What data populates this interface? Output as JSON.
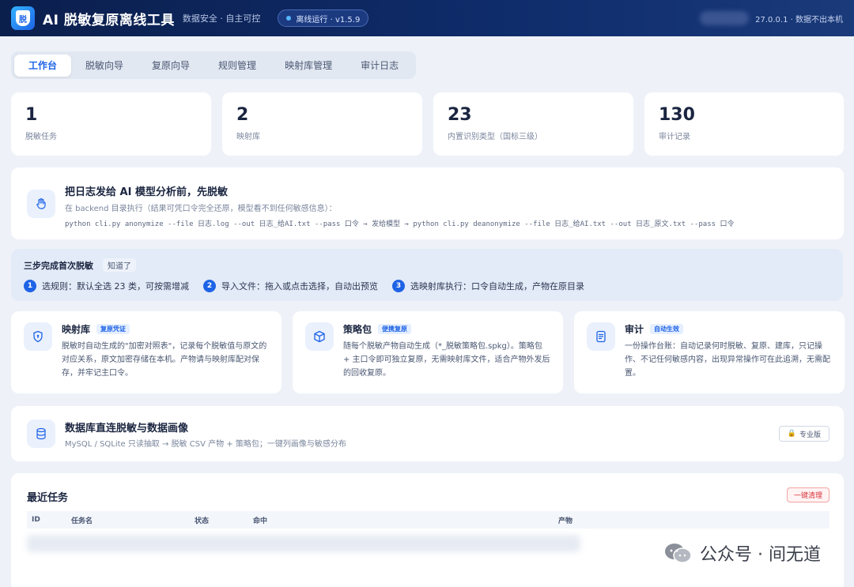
{
  "header": {
    "logo_text": "脱",
    "title": "AI 脱敏复原离线工具",
    "subtitle": "数据安全 · 自主可控",
    "status": "离线运行 · v1.5.9",
    "right_text": "27.0.0.1 · 数据不出本机"
  },
  "tabs": [
    {
      "label": "工作台",
      "active": true
    },
    {
      "label": "脱敏向导"
    },
    {
      "label": "复原向导"
    },
    {
      "label": "规则管理"
    },
    {
      "label": "映射库管理"
    },
    {
      "label": "审计日志"
    }
  ],
  "stats": [
    {
      "value": "1",
      "label": "脱敏任务"
    },
    {
      "value": "2",
      "label": "映射库"
    },
    {
      "value": "23",
      "label": "内置识别类型（国标三级）"
    },
    {
      "value": "130",
      "label": "审计记录"
    }
  ],
  "hero": {
    "title": "把日志发给 AI 模型分析前，先脱敏",
    "desc": "在 backend 目录执行（结果可凭口令完全还原，模型看不到任何敏感信息）：",
    "cmd": "python cli.py anonymize --file 日志.log --out 日志_给AI.txt --pass 口令 → 发给模型 → python cli.py deanonymize --file 日志_给AI.txt --out 日志_原文.txt --pass 口令"
  },
  "steps": {
    "title": "三步完成首次脱敏",
    "ack": "知道了",
    "items": [
      {
        "num": "1",
        "text": "选规则：默认全选 23 类，可按需增减"
      },
      {
        "num": "2",
        "text": "导入文件：拖入或点击选择，自动出预览"
      },
      {
        "num": "3",
        "text": "选映射库执行：口令自动生成，产物在原目录"
      }
    ]
  },
  "features": [
    {
      "icon": "shield-icon",
      "title": "映射库",
      "badge": "复原凭证",
      "desc": "脱敏时自动生成的\"加密对照表\"，记录每个脱敏值与原文的对应关系，原文加密存储在本机。产物请与映射库配对保存，并牢记主口令。"
    },
    {
      "icon": "package-icon",
      "title": "策略包",
      "badge": "便携复原",
      "desc": "随每个脱敏产物自动生成（*_脱敏策略包.spkg）。策略包 + 主口令即可独立复原，无需映射库文件，适合产物外发后的回收复原。"
    },
    {
      "icon": "document-icon",
      "title": "审计",
      "badge": "自动生效",
      "desc": "一份操作台账：自动记录何时脱敏、复原、建库，只记操作、不记任何敏感内容，出现异常操作可在此追溯，无需配置。"
    }
  ],
  "db": {
    "title": "数据库直连脱敏与数据画像",
    "desc": "MySQL / SQLite 只读抽取 → 脱敏 CSV 产物 + 策略包；一键列画像与敏感分布",
    "pro": "专业版"
  },
  "recent": {
    "title": "最近任务",
    "clear": "一键清理",
    "columns": [
      "ID",
      "任务名",
      "状态",
      "命中",
      "产物"
    ]
  },
  "watermark": "公众号 · 间无道",
  "colors": {
    "accent": "#1e63e6",
    "header": "#0f2c6b",
    "danger": "#d9363e"
  }
}
